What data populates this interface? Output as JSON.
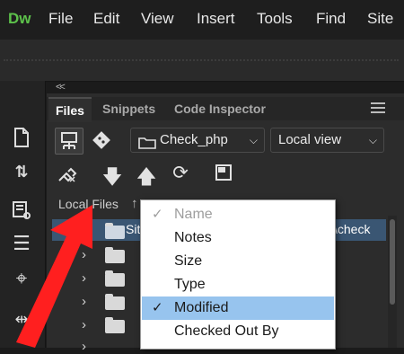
{
  "app": {
    "logo": "Dw"
  },
  "menu": [
    "File",
    "Edit",
    "View",
    "Insert",
    "Tools",
    "Find",
    "Site"
  ],
  "panel": {
    "collapse_glyph": "<<",
    "tabs": [
      "Files",
      "Snippets",
      "Code Inspector"
    ],
    "active_tab": "Files"
  },
  "files": {
    "site_select": "Check_php",
    "view_select": "Local view",
    "local_files_label": "Local Files",
    "site_row_label": "Sit",
    "site_row_path": "\\check"
  },
  "context_menu": {
    "items": [
      {
        "label": "Name",
        "checked": true,
        "disabled": true,
        "selected": false
      },
      {
        "label": "Notes",
        "checked": false,
        "disabled": false,
        "selected": false
      },
      {
        "label": "Size",
        "checked": false,
        "disabled": false,
        "selected": false
      },
      {
        "label": "Type",
        "checked": false,
        "disabled": false,
        "selected": false
      },
      {
        "label": "Modified",
        "checked": true,
        "disabled": false,
        "selected": true
      },
      {
        "label": "Checked Out By",
        "checked": false,
        "disabled": false,
        "selected": false
      }
    ]
  },
  "icons": [
    "page-icon",
    "transfer-icon",
    "file-inspect-icon",
    "align-icon",
    "target-icon",
    "expand-icon",
    "connect-icon",
    "git-icon",
    "disconnect-icon",
    "get-files-icon",
    "put-files-icon",
    "refresh-icon",
    "expand-view-icon",
    "up-arrow-icon",
    "hamburger-icon"
  ],
  "colors": {
    "accent_selection": "#97c4ee",
    "site_row": "#3a5673",
    "annotation_arrow": "#ff1f1f",
    "logo": "#5dc24b"
  }
}
